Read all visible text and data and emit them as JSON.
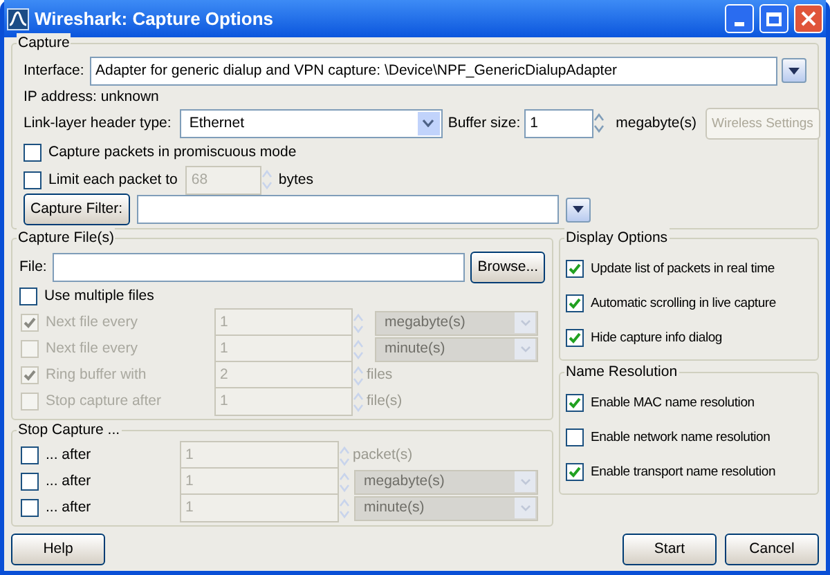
{
  "window": {
    "title": "Wireshark: Capture Options"
  },
  "capture": {
    "title": "Capture",
    "interface_label": "Interface:",
    "interface_value": "Adapter for generic dialup and VPN capture: \\Device\\NPF_GenericDialupAdapter",
    "ip_address": "IP address: unknown",
    "link_layer_label": "Link-layer header type:",
    "link_layer_value": "Ethernet",
    "buffer_label": "Buffer size:",
    "buffer_value": "1",
    "buffer_unit": "megabyte(s)",
    "wireless_button": {
      "label": "Wireless Settings",
      "disabled": true
    },
    "promiscuous": {
      "label": "Capture packets in promiscuous mode",
      "checked": false
    },
    "limit": {
      "label": "Limit each packet to",
      "checked": false,
      "value": "68",
      "unit": "bytes"
    },
    "filter_button": "Capture Filter:"
  },
  "capture_files": {
    "title": "Capture File(s)",
    "file_label": "File:",
    "browse_button": "Browse...",
    "multiple_files": {
      "label": "Use multiple files",
      "checked": false
    },
    "rows": [
      {
        "label": "Next file every",
        "checked": true,
        "disabled": true,
        "value": "1",
        "unit": "megabyte(s)",
        "kind": "dropdown"
      },
      {
        "label": "Next file every",
        "checked": false,
        "disabled": true,
        "value": "1",
        "unit": "minute(s)",
        "kind": "dropdown"
      },
      {
        "label": "Ring buffer with",
        "checked": true,
        "disabled": true,
        "value": "2",
        "unit": "files",
        "kind": "text"
      },
      {
        "label": "Stop capture after",
        "checked": false,
        "disabled": true,
        "value": "1",
        "unit": "file(s)",
        "kind": "text"
      }
    ]
  },
  "stop_capture": {
    "title": "Stop Capture ...",
    "rows": [
      {
        "label": "... after",
        "checked": false,
        "value": "1",
        "unit": "packet(s)",
        "kind": "text"
      },
      {
        "label": "... after",
        "checked": false,
        "value": "1",
        "unit": "megabyte(s)",
        "kind": "dropdown"
      },
      {
        "label": "... after",
        "checked": false,
        "value": "1",
        "unit": "minute(s)",
        "kind": "dropdown"
      }
    ]
  },
  "display_options": {
    "title": "Display Options",
    "items": [
      {
        "label": "Update list of packets in real time",
        "checked": true
      },
      {
        "label": "Automatic scrolling in live capture",
        "checked": true
      },
      {
        "label": "Hide capture info dialog",
        "checked": true
      }
    ]
  },
  "name_resolution": {
    "title": "Name Resolution",
    "items": [
      {
        "label": "Enable MAC name resolution",
        "checked": true
      },
      {
        "label": "Enable network name resolution",
        "checked": false
      },
      {
        "label": "Enable transport name resolution",
        "checked": true
      }
    ]
  },
  "buttons": [
    {
      "label": "Help"
    },
    {
      "label": "Start"
    },
    {
      "label": "Cancel"
    }
  ]
}
